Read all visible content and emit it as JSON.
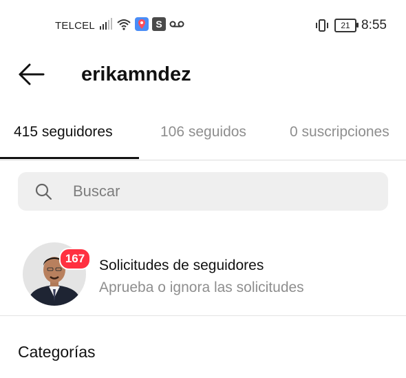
{
  "status_bar": {
    "carrier": "TELCEL",
    "battery_level": "21",
    "time": "8:55",
    "icons": [
      "signal-icon",
      "wifi-icon",
      "location-app-icon",
      "s-app-icon",
      "voicemail-icon",
      "vibrate-icon",
      "battery-icon"
    ]
  },
  "header": {
    "back_icon": "arrow-left-icon",
    "username": "erikamndez"
  },
  "tabs": [
    {
      "label": "415 seguidores",
      "active": true
    },
    {
      "label": "106 seguidos",
      "active": false
    },
    {
      "label": "0 suscripciones",
      "active": false
    }
  ],
  "search": {
    "icon": "search-icon",
    "placeholder": "Buscar"
  },
  "follow_requests": {
    "badge_count": "167",
    "title": "Solicitudes de seguidores",
    "subtitle": "Aprueba o ignora las solicitudes"
  },
  "categories": {
    "title": "Categorías"
  },
  "colors": {
    "badge": "#ff3040",
    "muted_text": "#8e8e8e",
    "search_bg": "#efefef"
  }
}
